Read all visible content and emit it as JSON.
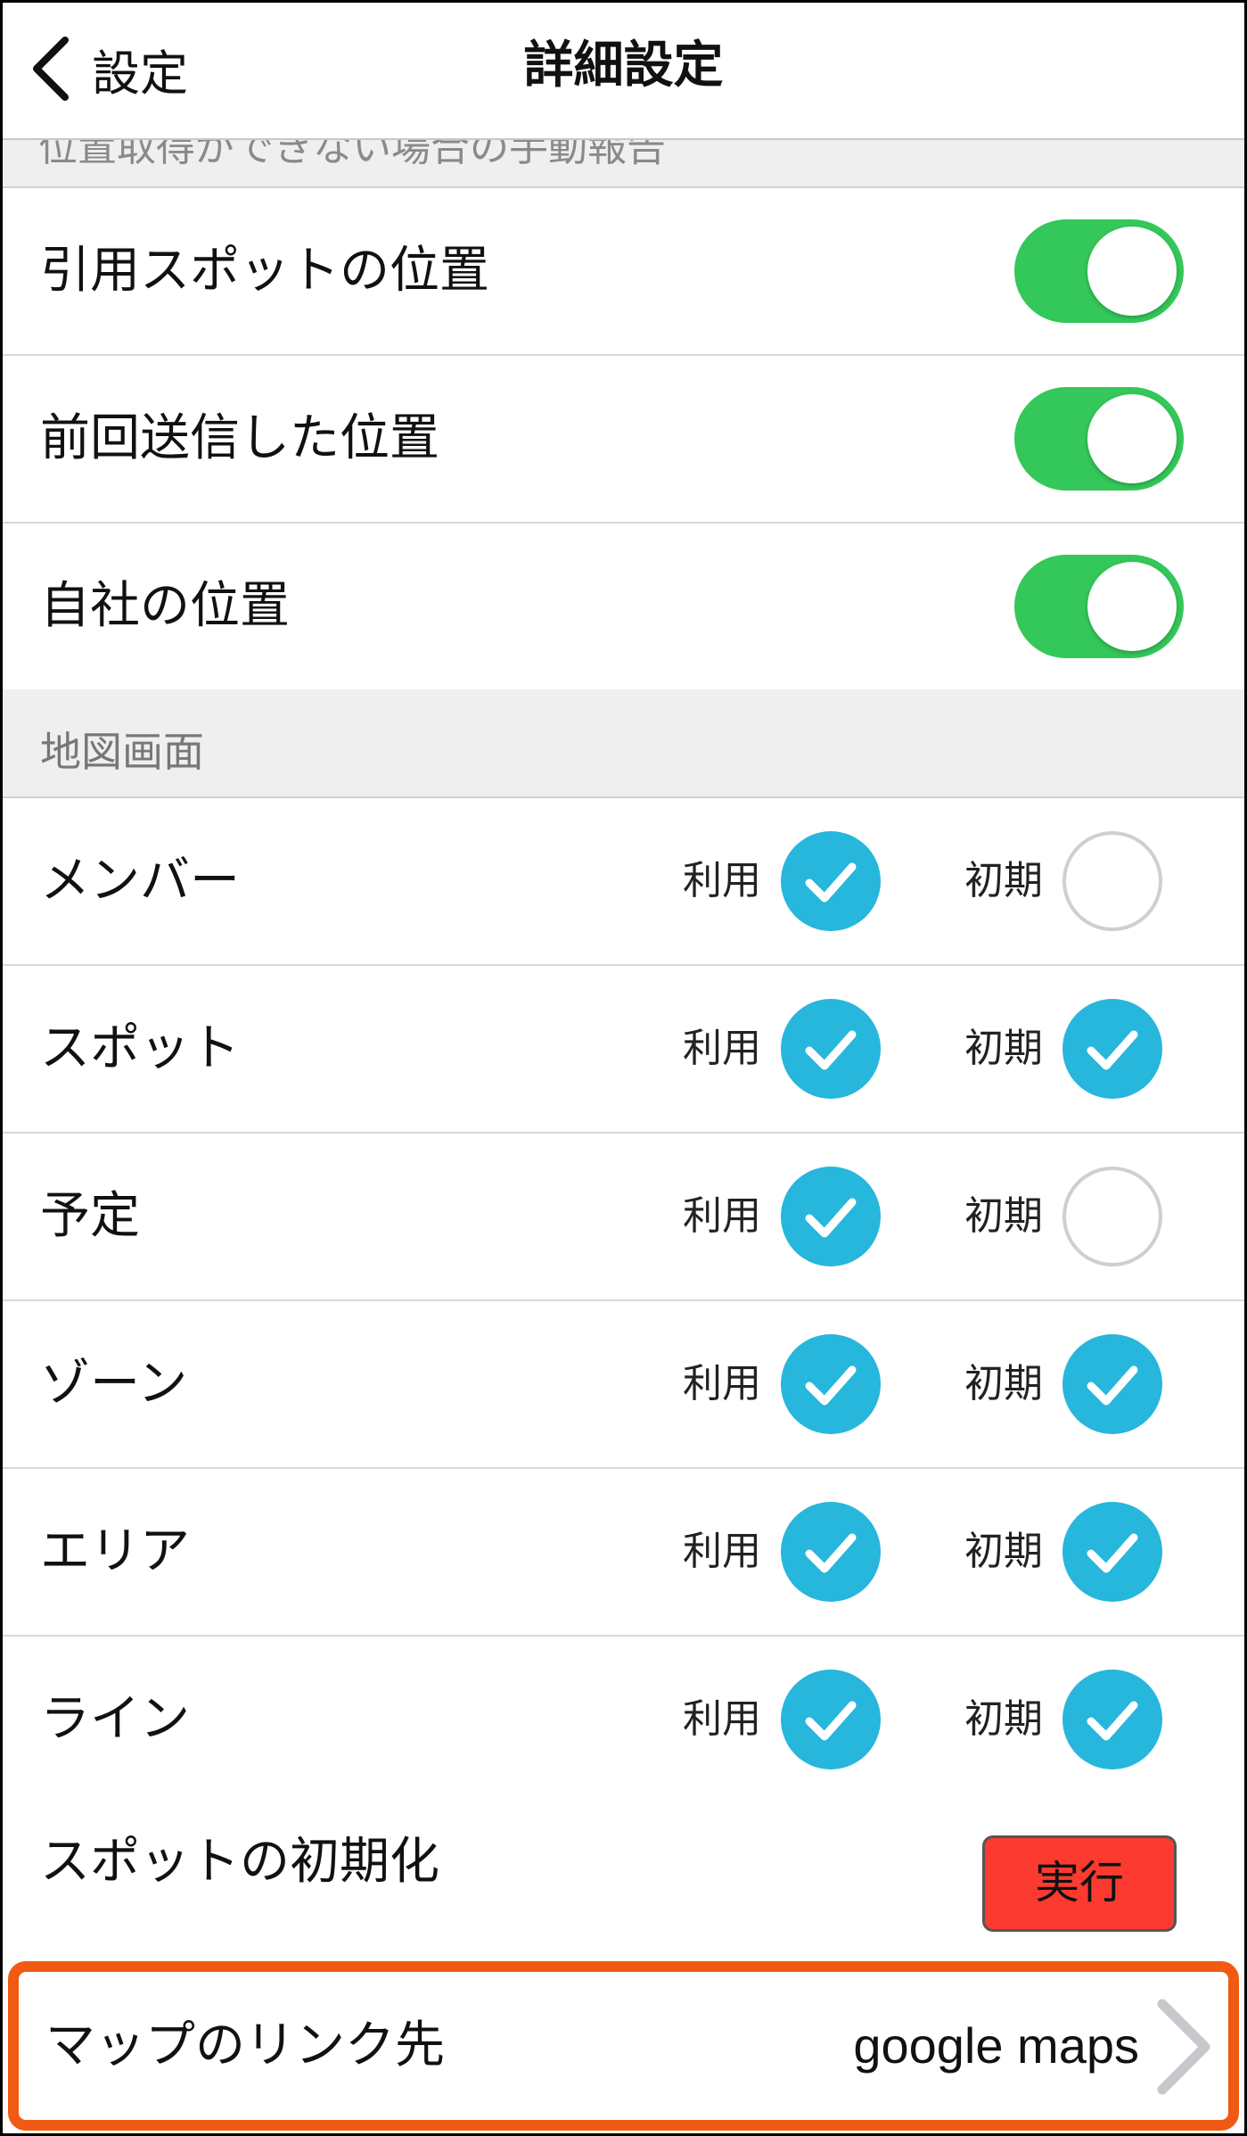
{
  "nav": {
    "back_label": "設定",
    "title": "詳細設定"
  },
  "cut_section_header": "位置取得ができない場合の手動報告",
  "toggle_rows": [
    {
      "label": "引用スポットの位置",
      "on": true
    },
    {
      "label": "前回送信した位置",
      "on": true
    },
    {
      "label": "自社の位置",
      "on": true
    }
  ],
  "map_section": {
    "header": "地図画面",
    "use_label": "利用",
    "init_label": "初期",
    "items": [
      {
        "label": "メンバー",
        "use": true,
        "init": false
      },
      {
        "label": "スポット",
        "use": true,
        "init": true
      },
      {
        "label": "予定",
        "use": true,
        "init": false
      },
      {
        "label": "ゾーン",
        "use": true,
        "init": true
      },
      {
        "label": "エリア",
        "use": true,
        "init": true
      },
      {
        "label": "ライン",
        "use": true,
        "init": true
      }
    ]
  },
  "reset_spot": {
    "label": "スポットの初期化",
    "button": "実行"
  },
  "map_link": {
    "label": "マップのリンク先",
    "value": "google maps"
  },
  "colors": {
    "toggle_on": "#34c759",
    "check_on": "#27b6dc",
    "exec_button": "#fc3a2f",
    "highlight_border": "#f05a13"
  }
}
